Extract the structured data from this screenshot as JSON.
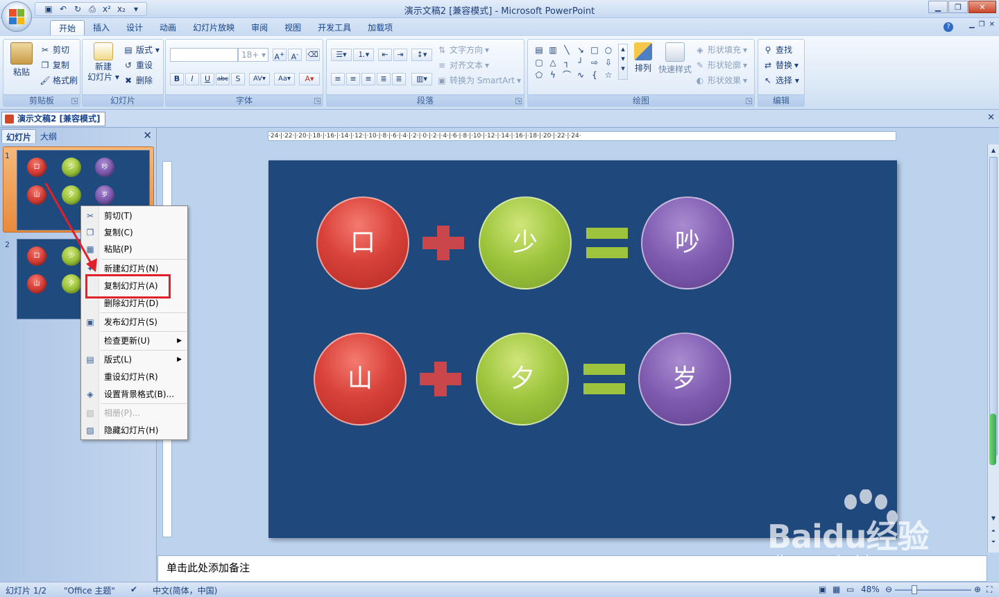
{
  "window": {
    "title": "演示文稿2 [兼容模式] - Microsoft PowerPoint",
    "doc_tab": "演示文稿2 [兼容模式]"
  },
  "qat": [
    "save-icon",
    "undo-icon",
    "redo-icon",
    "print-preview-icon",
    "superscript-icon",
    "subscript-icon"
  ],
  "qat_labels": {
    "superscript": "x²",
    "subscript": "x₂"
  },
  "tabs": [
    "开始",
    "插入",
    "设计",
    "动画",
    "幻灯片放映",
    "审阅",
    "视图",
    "开发工具",
    "加载项"
  ],
  "ribbon": {
    "clipboard": {
      "label": "剪贴板",
      "paste": "粘贴",
      "cut": "剪切",
      "copy": "复制",
      "format_painter": "格式刷"
    },
    "slides": {
      "label": "幻灯片",
      "new_slide": "新建\n幻灯片",
      "new_slide_l1": "新建",
      "new_slide_l2": "幻灯片 ▾",
      "layout": "版式 ▾",
      "reset": "重设",
      "delete": "删除"
    },
    "font": {
      "label": "字体",
      "size": "18+"
    },
    "paragraph": {
      "label": "段落",
      "text_direction": "文字方向",
      "align_text": "对齐文本",
      "smartart": "转换为 SmartArt"
    },
    "drawing": {
      "label": "绘图",
      "arrange": "排列",
      "quick_styles": "快速样式",
      "shape_fill": "形状填充",
      "shape_outline": "形状轮廓",
      "shape_effects": "形状效果"
    },
    "editing": {
      "label": "编辑",
      "find": "查找",
      "replace": "替换",
      "select": "选择 ▾"
    }
  },
  "left_pane": {
    "tabs": [
      "幻灯片",
      "大纲"
    ],
    "slides": [
      {
        "number": "1",
        "row1": [
          "口",
          "少",
          "吵"
        ],
        "row2": [
          "山",
          "夕",
          "岁"
        ]
      },
      {
        "number": "2",
        "row1": [
          "口",
          "少"
        ],
        "row2": [
          "山",
          "夕"
        ]
      }
    ]
  },
  "context_menu": {
    "items": [
      {
        "label": "剪切(T)",
        "icon": "scissors-icon",
        "enabled": true
      },
      {
        "label": "复制(C)",
        "icon": "copy-icon",
        "enabled": true
      },
      {
        "label": "粘贴(P)",
        "icon": "paste-icon",
        "enabled": true
      },
      {
        "label": "新建幻灯片(N)",
        "icon": "new-slide-icon",
        "enabled": true
      },
      {
        "label": "复制幻灯片(A)",
        "icon": "",
        "enabled": true,
        "highlighted": true
      },
      {
        "label": "删除幻灯片(D)",
        "icon": "",
        "enabled": true
      },
      {
        "label": "发布幻灯片(S)",
        "icon": "publish-icon",
        "enabled": true
      },
      {
        "label": "检查更新(U)",
        "icon": "",
        "enabled": true,
        "submenu": true
      },
      {
        "label": "版式(L)",
        "icon": "layout-icon",
        "enabled": true,
        "submenu": true
      },
      {
        "label": "重设幻灯片(R)",
        "icon": "",
        "enabled": true
      },
      {
        "label": "设置背景格式(B)...",
        "icon": "background-icon",
        "enabled": true
      },
      {
        "label": "相册(P)...",
        "icon": "album-icon",
        "enabled": false
      },
      {
        "label": "隐藏幻灯片(H)",
        "icon": "hide-slide-icon",
        "enabled": true
      }
    ]
  },
  "slide": {
    "row1": {
      "a": "口",
      "b": "少",
      "result": "吵"
    },
    "row2": {
      "a": "山",
      "b": "夕",
      "result": "岁"
    }
  },
  "notes_placeholder": "单击此处添加备注",
  "status": {
    "slide_count": "幻灯片 1/2",
    "theme": "\"Office 主题\"",
    "language": "中文(简体，中国)",
    "zoom": "48%"
  },
  "ruler_text": "·24·|·22·|·20·|·18·|·16·|·14·|·12·|·10·|·8·|·6·|·4·|·2·|·0·|·2·|·4·|·6·|·8·|·10·|·12·|·14·|·16·|·18·|·20·|·22·|·24·",
  "watermark": {
    "brand": "Baidu经验",
    "url": "jingyan.baidu.com"
  },
  "colors": {
    "slide_bg": "#1f497d",
    "red": "#d9423a",
    "green": "#9dc43c",
    "purple": "#7f5bb0",
    "highlight": "#e0202a"
  }
}
